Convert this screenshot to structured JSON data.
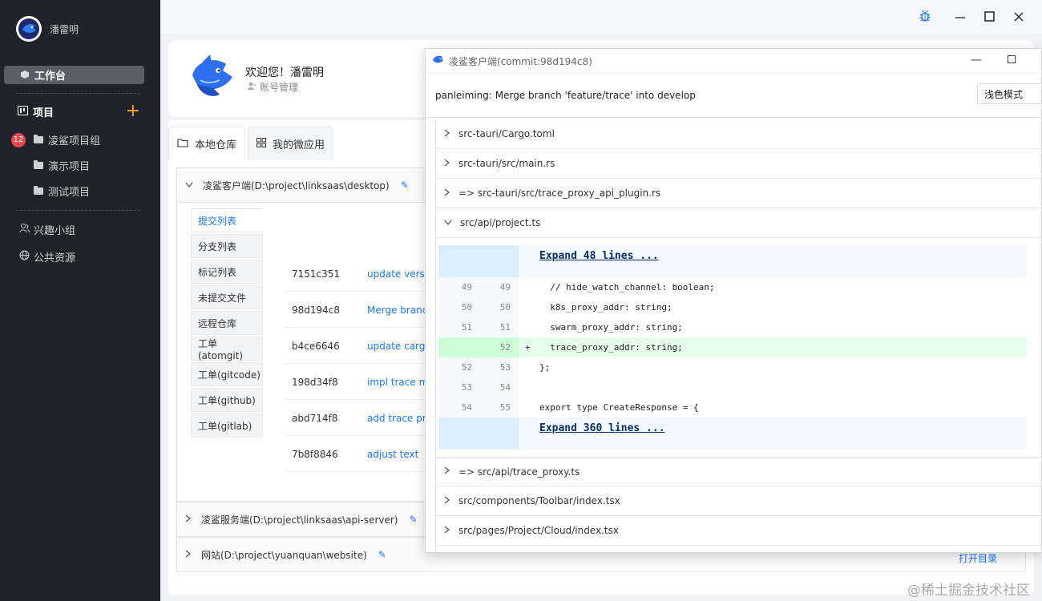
{
  "sidebar": {
    "username": "潘雷明",
    "workbench": "工作台",
    "projects_label": "项目",
    "add_label": "+",
    "badge": "12",
    "groups": [
      "凌鲨项目组",
      "演示项目",
      "测试项目"
    ],
    "extras": [
      "兴趣小组",
      "公共资源"
    ]
  },
  "profile": {
    "welcome": "欢迎您！潘雷明",
    "account": "账号管理"
  },
  "tabs": [
    "本地仓库",
    "我的微应用"
  ],
  "repos": [
    {
      "name": "凌鲨客户端(D:\\project\\linksaas\\desktop)"
    },
    {
      "name": "凌鲨服务端(D:\\project\\linksaas\\api-server)"
    },
    {
      "name": "网站(D:\\project\\yuanquan\\website)"
    }
  ],
  "side_tabs": [
    "提交列表",
    "分支列表",
    "标记列表",
    "未提交文件",
    "远程仓库",
    "工单(atomgit)",
    "工单(gitcode)",
    "工单(github)",
    "工单(gitlab)"
  ],
  "commits": [
    {
      "hash": "7151c351",
      "msg": "update versi"
    },
    {
      "hash": "98d194c8",
      "msg": "Merge branc"
    },
    {
      "hash": "b4ce6646",
      "msg": "update carg"
    },
    {
      "hash": "198d34f8",
      "msg": "impl trace m"
    },
    {
      "hash": "abd714f8",
      "msg": "add trace pr"
    },
    {
      "hash": "7b8f8846",
      "msg": "adjust text"
    }
  ],
  "open_dir": "打开目录",
  "popup": {
    "title": "凌鲨客户端(commit:98d194c8)",
    "commit_msg": "panleiming: Merge branch 'feature/trace' into develop",
    "mode": "浅色模式",
    "files_before": [
      "src-tauri/Cargo.toml",
      "src-tauri/src/main.rs",
      "=> src-tauri/src/trace_proxy_api_plugin.rs",
      "src/api/project.ts"
    ],
    "files_after": [
      "=> src/api/trace_proxy.ts",
      "src/components/Toolbar/index.tsx",
      "src/pages/Project/Cloud/index.tsx"
    ],
    "expand_top": "Expand 48 lines ...",
    "expand_bottom": "Expand 360 lines ...",
    "diff_lines": [
      {
        "old": "49",
        "new": "49",
        "sign": "",
        "code": "  // hide_watch_channel: boolean;",
        "added": false
      },
      {
        "old": "50",
        "new": "50",
        "sign": "",
        "code": "  k8s_proxy_addr: string;",
        "added": false
      },
      {
        "old": "51",
        "new": "51",
        "sign": "",
        "code": "  swarm_proxy_addr: string;",
        "added": false
      },
      {
        "old": "",
        "new": "52",
        "sign": "+",
        "code": "  trace_proxy_addr: string;",
        "added": true
      },
      {
        "old": "52",
        "new": "53",
        "sign": "",
        "code": "};",
        "added": false
      },
      {
        "old": "53",
        "new": "54",
        "sign": "",
        "code": "",
        "added": false
      },
      {
        "old": "54",
        "new": "55",
        "sign": "",
        "code": "export type CreateResponse = {",
        "added": false
      }
    ]
  },
  "watermark": "@稀土掘金技术社区",
  "colors": {
    "sidebar_bg": "#20232c",
    "accent": "#1677ff",
    "added_bg": "#e6ffec",
    "added_gutter": "#ccffd8",
    "badge": "#e5484d"
  }
}
